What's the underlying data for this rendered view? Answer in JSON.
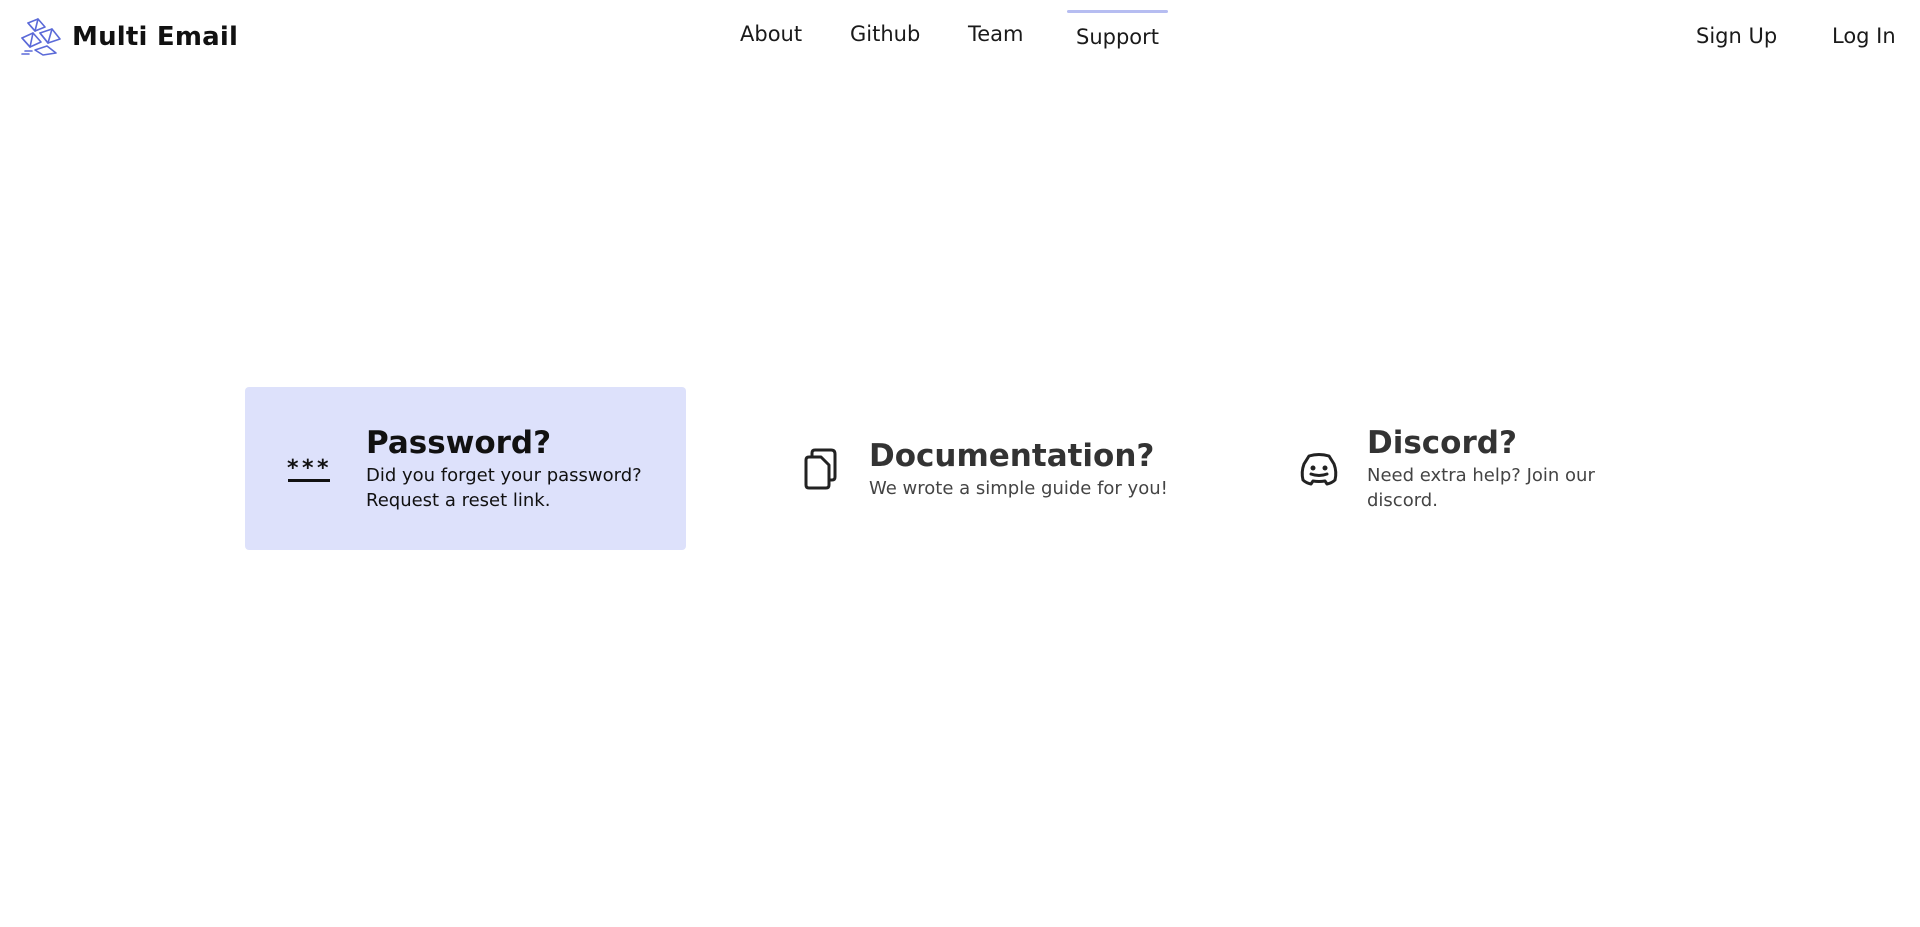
{
  "brand": {
    "name": "Multi Email",
    "logo_icon": "multi-email-logo-icon",
    "logo_color": "#5b6ad8"
  },
  "nav": {
    "items": [
      {
        "label": "About"
      },
      {
        "label": "Github"
      },
      {
        "label": "Team"
      },
      {
        "label": "Support",
        "active": true
      }
    ],
    "indicator_color": "#b6bdf1"
  },
  "auth": {
    "sign_up": "Sign Up",
    "log_in": "Log In"
  },
  "cards": [
    {
      "icon": "password-icon",
      "title": "Password?",
      "description": "Did you forget your password? Request a reset link.",
      "highlighted": true,
      "highlight_color": "#dde1fb"
    },
    {
      "icon": "documents-icon",
      "title": "Documentation?",
      "description": "We wrote a simple guide for you!",
      "highlighted": false
    },
    {
      "icon": "discord-icon",
      "title": "Discord?",
      "description": "Need extra help? Join our discord.",
      "highlighted": false
    }
  ]
}
